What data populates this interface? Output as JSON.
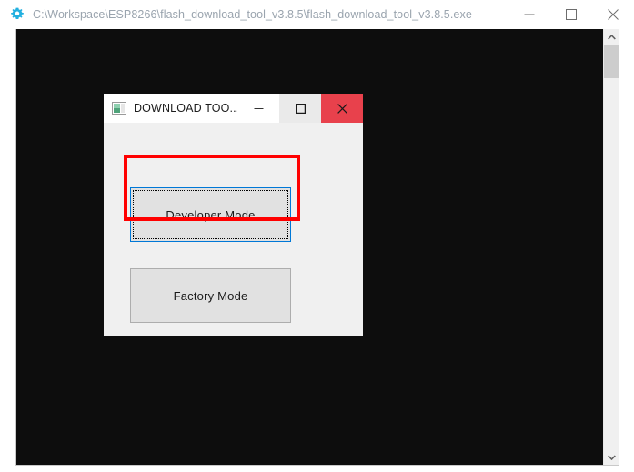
{
  "app_window": {
    "title": "C:\\Workspace\\ESP8266\\flash_download_tool_v3.8.5\\flash_download_tool_v3.8.5.exe",
    "icon": "gear-icon",
    "title_color": "#9aa4ae",
    "client_background": "#0d0d0d",
    "controls": {
      "minimize_label": "—",
      "maximize_label": "□",
      "close_label": "×"
    },
    "scrollbar": {
      "up_arrow": "chevron-up-icon",
      "down_arrow": "chevron-down-icon",
      "thumb_color": "#cdcdcd",
      "track_color": "#f0f0f0"
    }
  },
  "dialog": {
    "title": "DOWNLOAD TOO...",
    "icon": "picture-icon",
    "background": "#f0f0f0",
    "controls": {
      "minimize_label": "—",
      "maximize_label": "□",
      "close_label": "×",
      "close_background": "#e8414c"
    },
    "buttons": [
      {
        "id": "developer-mode",
        "label": "Developer Mode",
        "focused": true,
        "border_color": "#0078d7",
        "face_color": "#e1e1e1"
      },
      {
        "id": "factory-mode",
        "label": "Factory Mode",
        "focused": false,
        "border_color": "#adadad",
        "face_color": "#e1e1e1"
      }
    ]
  },
  "annotation": {
    "highlight_target": "Developer Mode",
    "highlight_color": "#ff0000"
  }
}
